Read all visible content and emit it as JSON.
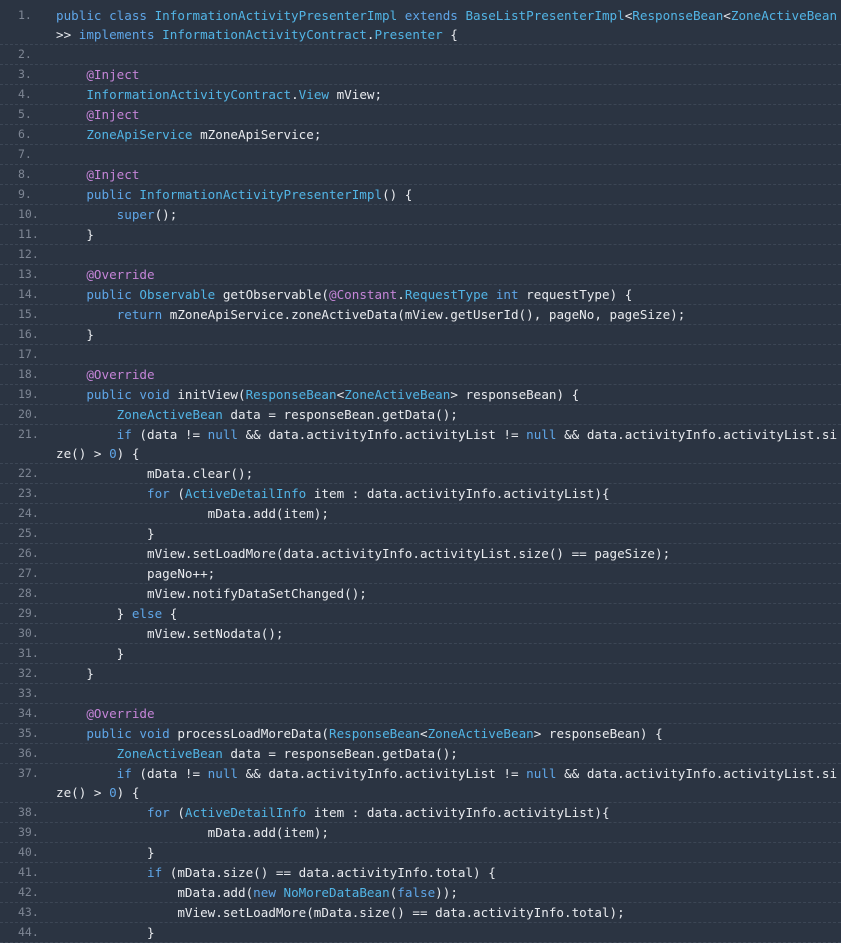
{
  "colors": {
    "background": "#2b3442",
    "keyword": "#5fa6e8",
    "type": "#52b5e6",
    "annotation": "#c585d8",
    "text": "#e8eaee",
    "line_number": "#7e8694"
  },
  "code_lines": [
    {
      "n": "1.",
      "wrap": true,
      "tokens": [
        [
          "kw",
          "public class "
        ],
        [
          "type",
          "InformationActivityPresenterImpl"
        ],
        [
          "kw",
          " extends "
        ],
        [
          "type",
          "BaseListPresenterImpl"
        ],
        [
          "plain",
          "<"
        ],
        [
          "type",
          "ResponseBean"
        ],
        [
          "plain",
          "<"
        ],
        [
          "type",
          "ZoneActiveBean"
        ],
        [
          "plain",
          ">> "
        ],
        [
          "kw",
          "implements "
        ],
        [
          "type",
          "InformationActivityContract"
        ],
        [
          "plain",
          "."
        ],
        [
          "type",
          "Presenter"
        ],
        [
          "plain",
          " {"
        ]
      ]
    },
    {
      "n": "2.",
      "tokens": []
    },
    {
      "n": "3.",
      "tokens": [
        [
          "plain",
          "    "
        ],
        [
          "ann",
          "@Inject"
        ]
      ]
    },
    {
      "n": "4.",
      "tokens": [
        [
          "plain",
          "    "
        ],
        [
          "type",
          "InformationActivityContract"
        ],
        [
          "plain",
          "."
        ],
        [
          "type",
          "View"
        ],
        [
          "plain",
          " mView;"
        ]
      ]
    },
    {
      "n": "5.",
      "tokens": [
        [
          "plain",
          "    "
        ],
        [
          "ann",
          "@Inject"
        ]
      ]
    },
    {
      "n": "6.",
      "tokens": [
        [
          "plain",
          "    "
        ],
        [
          "type",
          "ZoneApiService"
        ],
        [
          "plain",
          " mZoneApiService;"
        ]
      ]
    },
    {
      "n": "7.",
      "tokens": []
    },
    {
      "n": "8.",
      "tokens": [
        [
          "plain",
          "    "
        ],
        [
          "ann",
          "@Inject"
        ]
      ]
    },
    {
      "n": "9.",
      "tokens": [
        [
          "plain",
          "    "
        ],
        [
          "kw",
          "public "
        ],
        [
          "type",
          "InformationActivityPresenterImpl"
        ],
        [
          "plain",
          "() {"
        ]
      ]
    },
    {
      "n": "10.",
      "tokens": [
        [
          "plain",
          "        "
        ],
        [
          "kw",
          "super"
        ],
        [
          "plain",
          "();"
        ]
      ]
    },
    {
      "n": "11.",
      "tokens": [
        [
          "plain",
          "    }"
        ]
      ]
    },
    {
      "n": "12.",
      "tokens": []
    },
    {
      "n": "13.",
      "tokens": [
        [
          "plain",
          "    "
        ],
        [
          "ann",
          "@Override"
        ]
      ]
    },
    {
      "n": "14.",
      "tokens": [
        [
          "plain",
          "    "
        ],
        [
          "kw",
          "public "
        ],
        [
          "type",
          "Observable"
        ],
        [
          "plain",
          " getObservable("
        ],
        [
          "ann",
          "@Constant"
        ],
        [
          "plain",
          "."
        ],
        [
          "type",
          "RequestType"
        ],
        [
          "kw",
          " int"
        ],
        [
          "plain",
          " requestType) {"
        ]
      ]
    },
    {
      "n": "15.",
      "tokens": [
        [
          "plain",
          "        "
        ],
        [
          "kw",
          "return"
        ],
        [
          "plain",
          " mZoneApiService.zoneActiveData(mView.getUserId(), pageNo, pageSize);"
        ]
      ]
    },
    {
      "n": "16.",
      "tokens": [
        [
          "plain",
          "    }"
        ]
      ]
    },
    {
      "n": "17.",
      "tokens": []
    },
    {
      "n": "18.",
      "tokens": [
        [
          "plain",
          "    "
        ],
        [
          "ann",
          "@Override"
        ]
      ]
    },
    {
      "n": "19.",
      "tokens": [
        [
          "plain",
          "    "
        ],
        [
          "kw",
          "public void "
        ],
        [
          "plain",
          "initView("
        ],
        [
          "type",
          "ResponseBean"
        ],
        [
          "plain",
          "<"
        ],
        [
          "type",
          "ZoneActiveBean"
        ],
        [
          "plain",
          "> responseBean) {"
        ]
      ]
    },
    {
      "n": "20.",
      "tokens": [
        [
          "plain",
          "        "
        ],
        [
          "type",
          "ZoneActiveBean"
        ],
        [
          "plain",
          " data = responseBean.getData();"
        ]
      ]
    },
    {
      "n": "21.",
      "wrap": true,
      "tokens": [
        [
          "plain",
          "        "
        ],
        [
          "kw",
          "if"
        ],
        [
          "plain",
          " (data != "
        ],
        [
          "kw",
          "null"
        ],
        [
          "plain",
          " && data.activityInfo.activityList != "
        ],
        [
          "kw",
          "null"
        ],
        [
          "plain",
          " && data.activityInfo.activityList.size() > "
        ],
        [
          "kw",
          "0"
        ],
        [
          "plain",
          ") {"
        ]
      ]
    },
    {
      "n": "22.",
      "tokens": [
        [
          "plain",
          "            mData.clear();"
        ]
      ]
    },
    {
      "n": "23.",
      "tokens": [
        [
          "plain",
          "            "
        ],
        [
          "kw",
          "for"
        ],
        [
          "plain",
          " ("
        ],
        [
          "type",
          "ActiveDetailInfo"
        ],
        [
          "plain",
          " item : data.activityInfo.activityList){"
        ]
      ]
    },
    {
      "n": "24.",
      "tokens": [
        [
          "plain",
          "                    mData.add(item);"
        ]
      ]
    },
    {
      "n": "25.",
      "tokens": [
        [
          "plain",
          "            }"
        ]
      ]
    },
    {
      "n": "26.",
      "tokens": [
        [
          "plain",
          "            mView.setLoadMore(data.activityInfo.activityList.size() == pageSize);"
        ]
      ]
    },
    {
      "n": "27.",
      "tokens": [
        [
          "plain",
          "            pageNo++;"
        ]
      ]
    },
    {
      "n": "28.",
      "tokens": [
        [
          "plain",
          "            mView.notifyDataSetChanged();"
        ]
      ]
    },
    {
      "n": "29.",
      "tokens": [
        [
          "plain",
          "        } "
        ],
        [
          "kw",
          "else"
        ],
        [
          "plain",
          " {"
        ]
      ]
    },
    {
      "n": "30.",
      "tokens": [
        [
          "plain",
          "            mView.setNodata();"
        ]
      ]
    },
    {
      "n": "31.",
      "tokens": [
        [
          "plain",
          "        }"
        ]
      ]
    },
    {
      "n": "32.",
      "tokens": [
        [
          "plain",
          "    }"
        ]
      ]
    },
    {
      "n": "33.",
      "tokens": []
    },
    {
      "n": "34.",
      "tokens": [
        [
          "plain",
          "    "
        ],
        [
          "ann",
          "@Override"
        ]
      ]
    },
    {
      "n": "35.",
      "tokens": [
        [
          "plain",
          "    "
        ],
        [
          "kw",
          "public void "
        ],
        [
          "plain",
          "processLoadMoreData("
        ],
        [
          "type",
          "ResponseBean"
        ],
        [
          "plain",
          "<"
        ],
        [
          "type",
          "ZoneActiveBean"
        ],
        [
          "plain",
          "> responseBean) {"
        ]
      ]
    },
    {
      "n": "36.",
      "tokens": [
        [
          "plain",
          "        "
        ],
        [
          "type",
          "ZoneActiveBean"
        ],
        [
          "plain",
          " data = responseBean.getData();"
        ]
      ]
    },
    {
      "n": "37.",
      "wrap": true,
      "tokens": [
        [
          "plain",
          "        "
        ],
        [
          "kw",
          "if"
        ],
        [
          "plain",
          " (data != "
        ],
        [
          "kw",
          "null"
        ],
        [
          "plain",
          " && data.activityInfo.activityList != "
        ],
        [
          "kw",
          "null"
        ],
        [
          "plain",
          " && data.activityInfo.activityList.size() > "
        ],
        [
          "kw",
          "0"
        ],
        [
          "plain",
          ") {"
        ]
      ]
    },
    {
      "n": "38.",
      "tokens": [
        [
          "plain",
          "            "
        ],
        [
          "kw",
          "for"
        ],
        [
          "plain",
          " ("
        ],
        [
          "type",
          "ActiveDetailInfo"
        ],
        [
          "plain",
          " item : data.activityInfo.activityList){"
        ]
      ]
    },
    {
      "n": "39.",
      "tokens": [
        [
          "plain",
          "                    mData.add(item);"
        ]
      ]
    },
    {
      "n": "40.",
      "tokens": [
        [
          "plain",
          "            }"
        ]
      ]
    },
    {
      "n": "41.",
      "tokens": [
        [
          "plain",
          "            "
        ],
        [
          "kw",
          "if"
        ],
        [
          "plain",
          " (mData.size() == data.activityInfo.total) {"
        ]
      ]
    },
    {
      "n": "42.",
      "tokens": [
        [
          "plain",
          "                mData.add("
        ],
        [
          "kw",
          "new "
        ],
        [
          "type",
          "NoMoreDataBean"
        ],
        [
          "plain",
          "("
        ],
        [
          "kw",
          "false"
        ],
        [
          "plain",
          "));"
        ]
      ]
    },
    {
      "n": "43.",
      "tokens": [
        [
          "plain",
          "                mView.setLoadMore(mData.size() == data.activityInfo.total);"
        ]
      ]
    },
    {
      "n": "44.",
      "tokens": [
        [
          "plain",
          "            }"
        ]
      ]
    }
  ]
}
